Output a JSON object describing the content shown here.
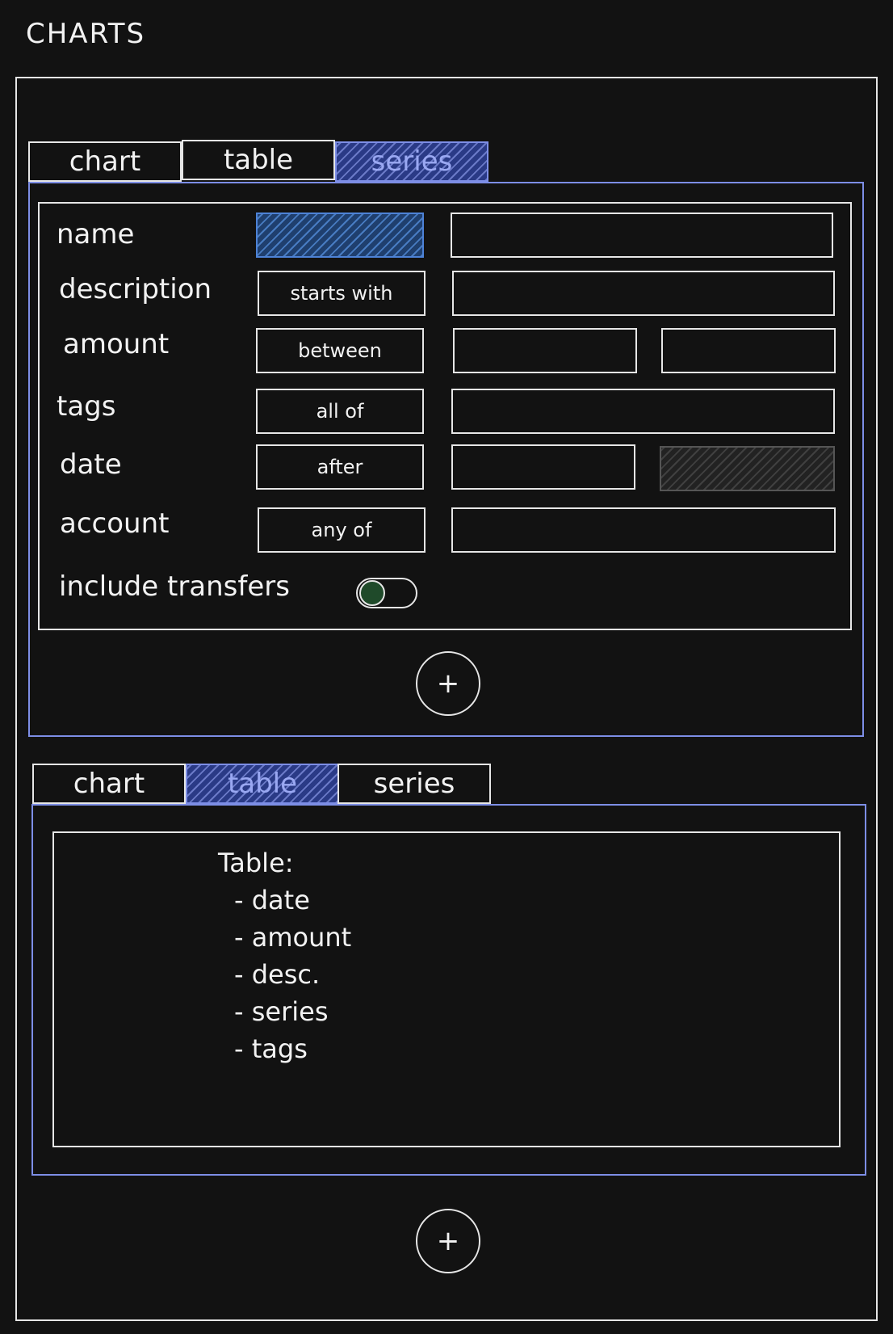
{
  "page": {
    "title": "CHARTS"
  },
  "tabs": {
    "chart": "chart",
    "table": "table",
    "series": "series"
  },
  "series_panel": {
    "active_tab": "series",
    "filters": [
      {
        "label": "name",
        "operator": ""
      },
      {
        "label": "description",
        "operator": "starts with"
      },
      {
        "label": "amount",
        "operator": "between"
      },
      {
        "label": "tags",
        "operator": "all of"
      },
      {
        "label": "date",
        "operator": "after"
      },
      {
        "label": "account",
        "operator": "any of"
      }
    ],
    "include_transfers": {
      "label": "include transfers",
      "value": true
    },
    "add_label": "+"
  },
  "table_panel": {
    "active_tab": "table",
    "heading": "Table:",
    "columns": [
      "- date",
      "- amount",
      "- desc.",
      "- series",
      "- tags"
    ]
  },
  "add_chart_label": "+",
  "colors": {
    "background": "#121212",
    "accent": "#7d8ee6",
    "line": "#e6e6e6",
    "selected_hatch": "#4d82d6"
  }
}
